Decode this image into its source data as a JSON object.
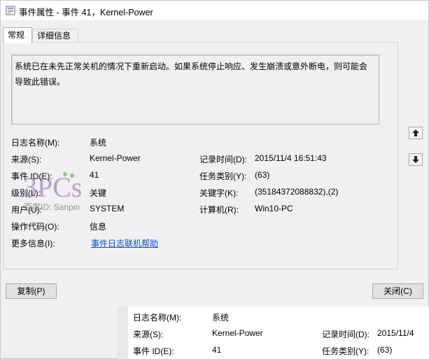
{
  "window": {
    "title": "事件属性 - 事件 41，Kernel-Power"
  },
  "tabs": [
    {
      "label": "常规",
      "active": true
    },
    {
      "label": "详细信息",
      "active": false
    }
  ],
  "description": "系统已在未先正常关机的情况下重新启动。如果系统停止响应、发生崩溃或意外断电，则可能会导致此错误。",
  "fields_left": [
    {
      "label": "日志名称(M):",
      "value": "系统"
    },
    {
      "label": "来源(S):",
      "value": "Kernel-Power"
    },
    {
      "label": "事件 ID(E):",
      "value": "41"
    },
    {
      "label": "级别(L):",
      "value": "关键"
    },
    {
      "label": "用户(U):",
      "value": "SYSTEM"
    },
    {
      "label": "操作代码(O):",
      "value": "信息"
    },
    {
      "label": "更多信息(I):",
      "value": "事件日志联机帮助"
    }
  ],
  "fields_right": [
    {
      "label": "记录时间(D):",
      "value": "2015/11/4 16:51:43"
    },
    {
      "label": "任务类别(Y):",
      "value": "(63)"
    },
    {
      "label": "关键字(K):",
      "value": "(35184372088832),(2)"
    },
    {
      "label": "计算机(R):",
      "value": "Win10-PC"
    }
  ],
  "buttons": {
    "copy": "复制(P)",
    "close": "关闭(C)"
  },
  "background_window": {
    "rows": [
      {
        "label": "日志名称(M):",
        "value": "系统",
        "label2": "",
        "value2": ""
      },
      {
        "label": "来源(S):",
        "value": "Kernel-Power",
        "label2": "记录时间(D):",
        "value2": "2015/11/4"
      },
      {
        "label": "事件 ID(E):",
        "value": "41",
        "label2": "任务类别(Y):",
        "value2": "(63)"
      }
    ]
  },
  "watermark": {
    "text": "百度ID: Sanpin",
    "logo": "3PCs"
  },
  "colors": {
    "link": "#0b50c8",
    "titlebar": "#ffffff",
    "dialog_bg": "#f0f0f0"
  }
}
